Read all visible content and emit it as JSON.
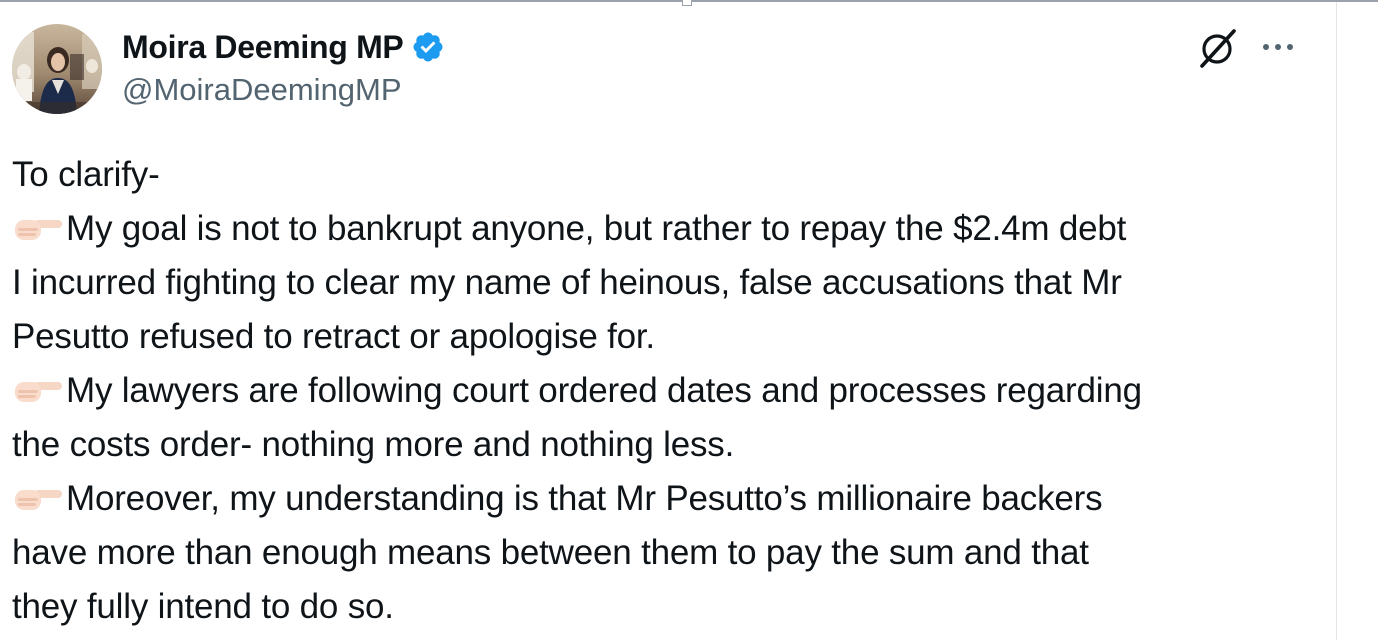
{
  "author": {
    "display_name": "Moira Deeming MP",
    "handle": "@MoiraDeemingMP",
    "verified": true,
    "verified_color": "#1d9bf0"
  },
  "icons": {
    "avatar": "profile-photo",
    "verified": "verified-badge-icon",
    "grok": "grok-icon",
    "more": "more-options-icon",
    "bullet": "backhand-index-pointing-right-emoji"
  },
  "tweet": {
    "lines": [
      {
        "emoji": false,
        "text": "To clarify-"
      },
      {
        "emoji": true,
        "text": "My goal is not to bankrupt anyone, but rather to repay the $2.4m debt"
      },
      {
        "emoji": false,
        "text": "I incurred fighting to clear my name of heinous, false accusations that Mr"
      },
      {
        "emoji": false,
        "text": "Pesutto refused to retract or apologise for."
      },
      {
        "emoji": true,
        "text": "My lawyers are following court ordered dates and processes regarding"
      },
      {
        "emoji": false,
        "text": "the costs order- nothing more and nothing less."
      },
      {
        "emoji": true,
        "text": "Moreover, my understanding is that Mr Pesutto’s millionaire backers"
      },
      {
        "emoji": false,
        "text": "have more than enough means between them to pay the sum and that"
      },
      {
        "emoji": false,
        "text": "they fully intend to do so."
      }
    ]
  },
  "colors": {
    "text": "#0f1419",
    "secondary_text": "#536471",
    "accent": "#1d9bf0"
  }
}
